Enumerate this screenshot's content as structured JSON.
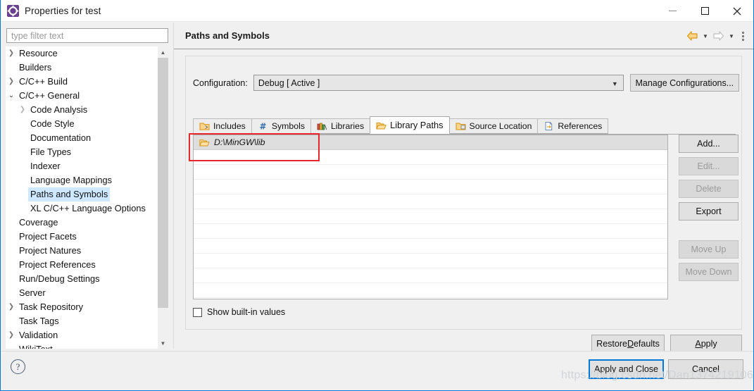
{
  "window": {
    "title": "Properties for test",
    "icon": "eclipse-properties-icon",
    "controls": {
      "minimize": "minimize-icon",
      "maximize": "maximize-icon",
      "close": "close-icon"
    }
  },
  "filter": {
    "placeholder": "type filter text",
    "value": ""
  },
  "tree": {
    "items": [
      {
        "label": "Resource",
        "indent": 0,
        "twisty": "collapsed",
        "selected": false
      },
      {
        "label": "Builders",
        "indent": 0,
        "twisty": "none",
        "selected": false
      },
      {
        "label": "C/C++ Build",
        "indent": 0,
        "twisty": "collapsed",
        "selected": false
      },
      {
        "label": "C/C++ General",
        "indent": 0,
        "twisty": "expanded",
        "selected": false
      },
      {
        "label": "Code Analysis",
        "indent": 1,
        "twisty": "collapsed-light",
        "selected": false
      },
      {
        "label": "Code Style",
        "indent": 1,
        "twisty": "none",
        "selected": false
      },
      {
        "label": "Documentation",
        "indent": 1,
        "twisty": "none",
        "selected": false
      },
      {
        "label": "File Types",
        "indent": 1,
        "twisty": "none",
        "selected": false
      },
      {
        "label": "Indexer",
        "indent": 1,
        "twisty": "none",
        "selected": false
      },
      {
        "label": "Language Mappings",
        "indent": 1,
        "twisty": "none",
        "selected": false
      },
      {
        "label": "Paths and Symbols",
        "indent": 1,
        "twisty": "none",
        "selected": true
      },
      {
        "label": "XL C/C++ Language Options",
        "indent": 1,
        "twisty": "none",
        "selected": false
      },
      {
        "label": "Coverage",
        "indent": 0,
        "twisty": "none",
        "selected": false
      },
      {
        "label": "Project Facets",
        "indent": 0,
        "twisty": "none",
        "selected": false
      },
      {
        "label": "Project Natures",
        "indent": 0,
        "twisty": "none",
        "selected": false
      },
      {
        "label": "Project References",
        "indent": 0,
        "twisty": "none",
        "selected": false
      },
      {
        "label": "Run/Debug Settings",
        "indent": 0,
        "twisty": "none",
        "selected": false
      },
      {
        "label": "Server",
        "indent": 0,
        "twisty": "none",
        "selected": false
      },
      {
        "label": "Task Repository",
        "indent": 0,
        "twisty": "collapsed",
        "selected": false
      },
      {
        "label": "Task Tags",
        "indent": 0,
        "twisty": "none",
        "selected": false
      },
      {
        "label": "Validation",
        "indent": 0,
        "twisty": "collapsed",
        "selected": false
      },
      {
        "label": "WikiText",
        "indent": 0,
        "twisty": "none",
        "selected": false
      }
    ]
  },
  "page": {
    "title": "Paths and Symbols",
    "toolbar": {
      "back": "back-arrow-icon",
      "back_menu": "chevron-down-icon",
      "forward": "forward-arrow-icon",
      "forward_menu": "chevron-down-icon",
      "overflow": "vertical-dots-icon"
    },
    "configuration": {
      "label": "Configuration:",
      "value": "Debug  [ Active ]",
      "manage_label": "Manage Configurations..."
    },
    "tabs": [
      {
        "label": "Includes",
        "icon": "includes-icon",
        "active": false
      },
      {
        "label": "Symbols",
        "icon": "hash-icon",
        "active": false
      },
      {
        "label": "Libraries",
        "icon": "books-icon",
        "active": false
      },
      {
        "label": "Library Paths",
        "icon": "open-folder-icon",
        "active": true
      },
      {
        "label": "Source Location",
        "icon": "source-folder-icon",
        "active": false
      },
      {
        "label": "References",
        "icon": "reference-page-icon",
        "active": false
      }
    ],
    "list": {
      "rows": [
        {
          "text": "D:\\MinGW\\lib",
          "icon": "folder-icon",
          "selected": true
        }
      ],
      "empty_rows": 10,
      "annotation": "red-highlight-box"
    },
    "show_builtin": {
      "label": "Show built-in values",
      "checked": false
    },
    "side_buttons": [
      {
        "label": "Add...",
        "enabled": true
      },
      {
        "label": "Edit...",
        "enabled": false
      },
      {
        "label": "Delete",
        "enabled": false
      },
      {
        "label": "Export",
        "enabled": true
      },
      {
        "label": "Move Up",
        "enabled": false
      },
      {
        "label": "Move Down",
        "enabled": false
      }
    ],
    "restore_defaults": {
      "pre": "Restore ",
      "mnemonic": "D",
      "post": "efaults"
    },
    "apply": {
      "pre": "",
      "mnemonic": "A",
      "post": "pply"
    }
  },
  "footer": {
    "help": "?",
    "apply_and_close": "Apply and Close",
    "cancel": "Cancel"
  },
  "watermark": "https://blog.csdn.net/Dan1374219106",
  "colors": {
    "accent": "#0078d7",
    "selection": "#cde8ff",
    "annotation": "#e8262c",
    "folder": "#f0ab3d"
  }
}
